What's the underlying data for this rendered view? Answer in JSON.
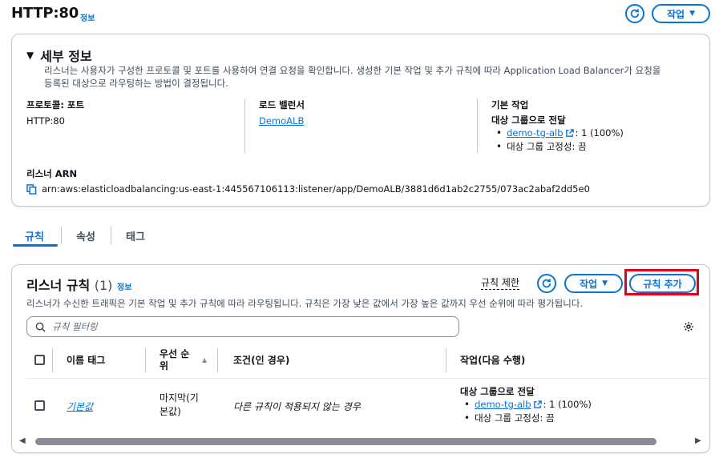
{
  "header": {
    "title": "HTTP:80",
    "info": "정보",
    "refresh_icon": "refresh-icon",
    "action_label": "작업"
  },
  "details": {
    "title": "세부 정보",
    "description_line1": "리스너는 사용자가 구성한 프로토콜 및 포트를 사용하여 연결 요청을 확인합니다. 생성한 기본 작업 및 추가 규칙에 따라 Application Load Balancer가 요청을",
    "description_line2": "등록된 대상으로 라우팅하는 방법이 결정됩니다.",
    "protocol_label": "프로토콜: 포트",
    "protocol_value": "HTTP:80",
    "lb_label": "로드 밸런서",
    "lb_value": "DemoALB",
    "default_action_label": "기본 작업",
    "default_action_title": "대상 그룹으로 전달",
    "target_group": "demo-tg-alb",
    "target_weight": ": 1 (100%)",
    "stickiness": "대상 그룹 고정성: 끔",
    "arn_label": "리스너 ARN",
    "arn_value": "arn:aws:elasticloadbalancing:us-east-1:445567106113:listener/app/DemoALB/3881d6d1ab2c2755/073ac2abaf2dd5e0"
  },
  "tabs": [
    {
      "label": "규칙",
      "active": true
    },
    {
      "label": "속성",
      "active": false
    },
    {
      "label": "태그",
      "active": false
    }
  ],
  "rules": {
    "title": "리스너 규칙",
    "count": "(1)",
    "info": "정보",
    "limit_label": "규칙 제한",
    "action_label": "작업",
    "add_rule_label": "규칙 추가",
    "description": "리스너가 수신한 트래픽은 기본 작업 및 추가 규칙에 따라 라우팅됩니다. 규칙은 가장 낮은 값에서 가장 높은 값까지 우선 순위에 따라 평가됩니다.",
    "search_placeholder": "규칙 필터링",
    "columns": {
      "name_tag": "이름 태그",
      "priority_line1": "우선 순",
      "priority_line2": "위",
      "conditions": "조건(인 경우)",
      "actions": "작업(다음 수행)"
    },
    "row": {
      "name": "기본값",
      "priority_line1": "마지막(기",
      "priority_line2": "본값)",
      "condition": "다른 규칙이 적용되지 않는 경우",
      "action_title": "대상 그룹으로 전달",
      "target_group": "demo-tg-alb",
      "target_weight": ": 1 (100%)",
      "stickiness": "대상 그룹 고정성: 끔"
    }
  },
  "colors": {
    "accent": "#0972d3",
    "highlight": "#e0001b",
    "border": "#c6c6cd"
  }
}
